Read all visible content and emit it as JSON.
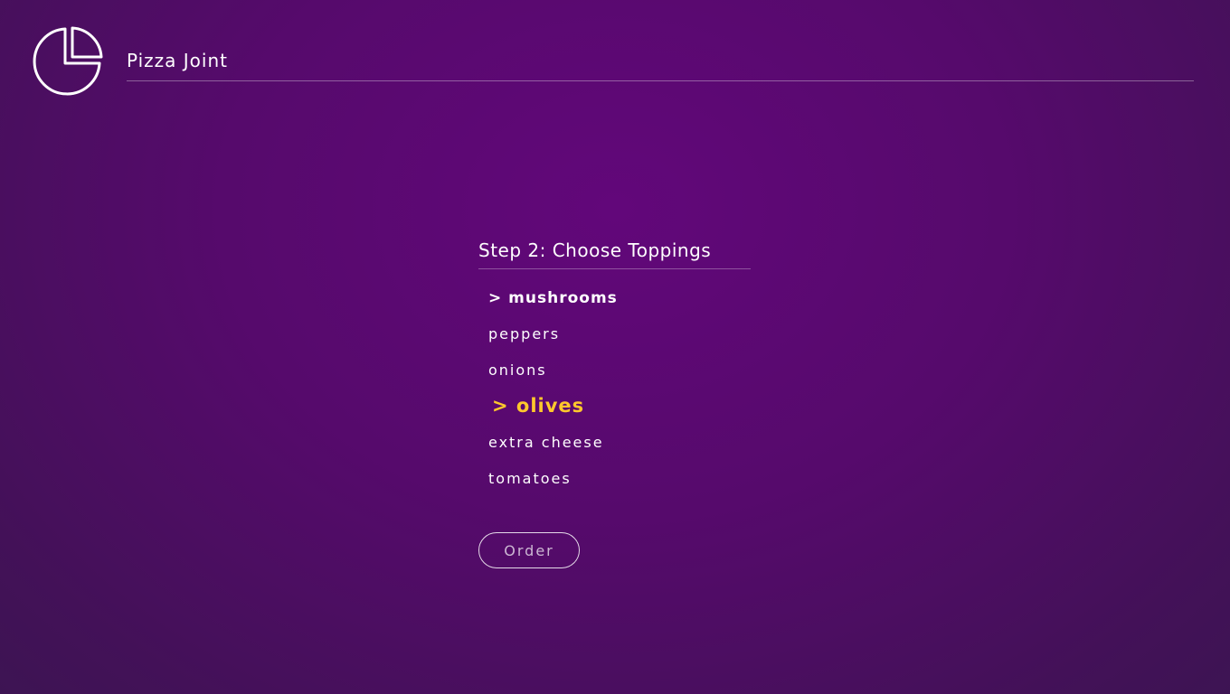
{
  "app": {
    "title": "Pizza Joint",
    "logo_icon": "pie-chart-icon"
  },
  "step": {
    "title": "Step 2: Choose Toppings"
  },
  "toppings": [
    {
      "label": "> mushrooms",
      "state": "selected"
    },
    {
      "label": "peppers",
      "state": "normal"
    },
    {
      "label": "onions",
      "state": "normal"
    },
    {
      "label": "> olives",
      "state": "focused"
    },
    {
      "label": "extra cheese",
      "state": "normal"
    },
    {
      "label": "tomatoes",
      "state": "normal"
    }
  ],
  "order_button": {
    "label": "Order"
  },
  "colors": {
    "background": "#5a086f",
    "accent": "#ffc82c",
    "text": "#ffffff"
  }
}
